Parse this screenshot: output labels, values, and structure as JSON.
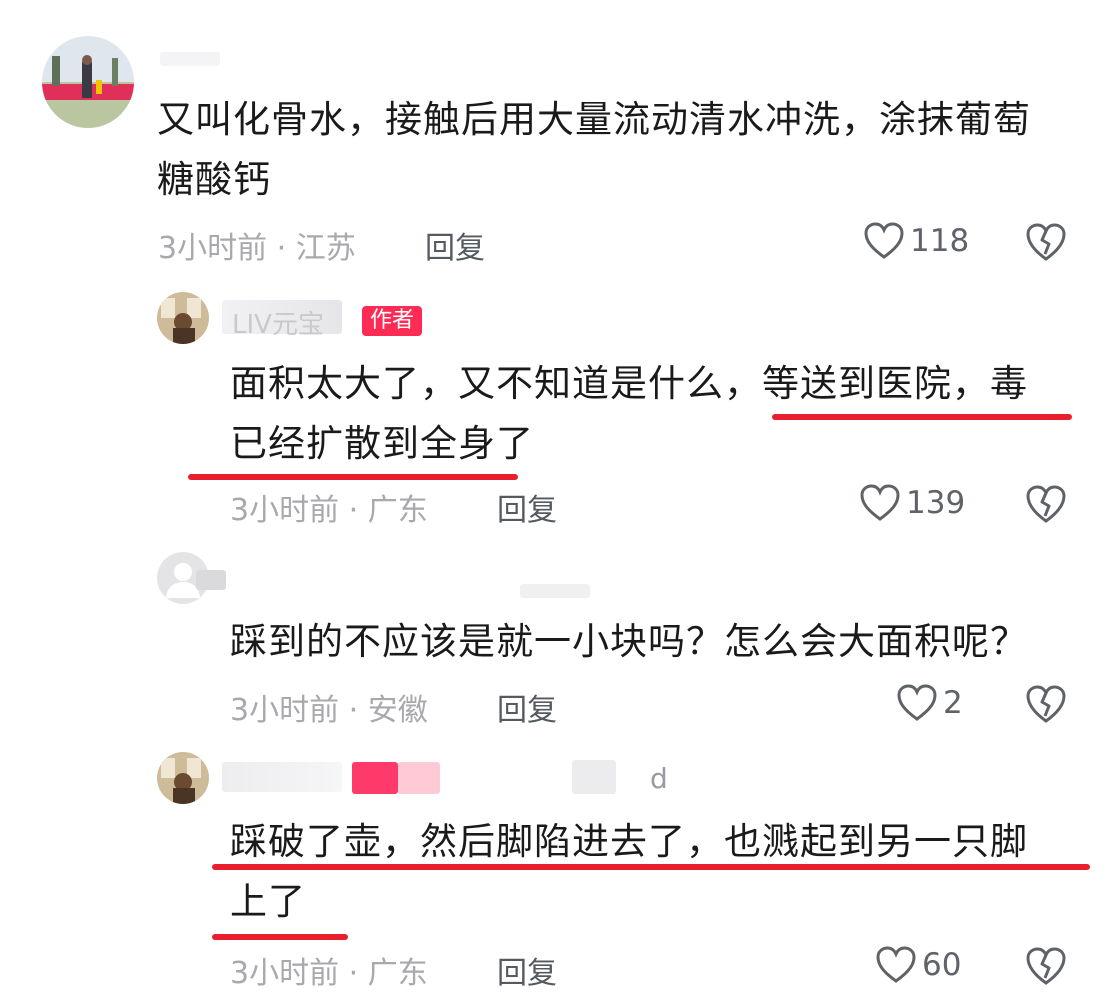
{
  "comments": [
    {
      "text": "又叫化骨水，接触后用大量流动清水冲洗，涂抹葡萄糖酸钙",
      "line1": "又叫化骨水，接触后用大量流动清水冲洗，涂抹葡萄",
      "line2": "糖酸钙",
      "time": "3小时前",
      "location": "江苏",
      "reply_label": "回复",
      "likes": "118"
    },
    {
      "username": "LIV元宝",
      "author_badge": "作者",
      "text": "面积太大了，又不知道是什么，等送到医院，毒已经扩散到全身了",
      "line1": "面积太大了，又不知道是什么，等送到医院，毒",
      "line2": "已经扩散到全身了",
      "time": "3小时前",
      "location": "广东",
      "reply_label": "回复",
      "likes": "139"
    },
    {
      "text": "踩到的不应该是就一小块吗？怎么会大面积呢？",
      "time": "3小时前",
      "location": "安徽",
      "reply_label": "回复",
      "likes": "2"
    },
    {
      "text": "踩破了壶，然后脚陷进去了，也溅起到另一只脚上了",
      "line1": "踩破了壶，然后脚陷进去了，也溅起到另一只脚",
      "line2": "上了",
      "name_fragment": "d",
      "time": "3小时前",
      "location": "广东",
      "reply_label": "回复",
      "likes": "60"
    }
  ],
  "separator": " · ",
  "colors": {
    "underline": "#e8202e",
    "badge": "#fe2c55",
    "meta": "#a8a8ad"
  },
  "icons": {
    "like": "heart-outline-icon",
    "dislike": "broken-heart-icon"
  }
}
